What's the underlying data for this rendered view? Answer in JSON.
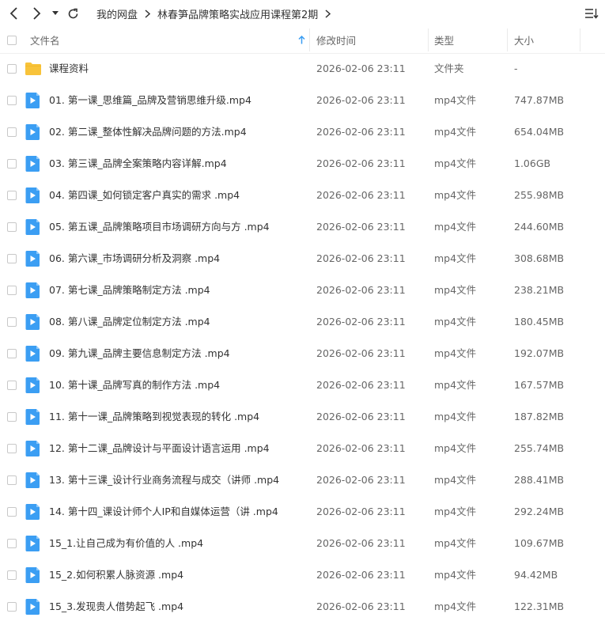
{
  "breadcrumb": [
    "我的网盘",
    "林春笋品牌策略实战应用课程第2期"
  ],
  "columns": {
    "name": "文件名",
    "modified": "修改时间",
    "type": "类型",
    "size": "大小"
  },
  "colors": {
    "folder": "#F8C33A",
    "video": "#3B9EF3"
  },
  "files": [
    {
      "icon": "folder-icon",
      "name": "课程资料",
      "modified": "2026-02-06 23:11",
      "type": "文件夹",
      "size": "-"
    },
    {
      "icon": "video-file-icon",
      "name": "01. 第一课_思维篇_品牌及营销思维升级.mp4",
      "modified": "2026-02-06 23:11",
      "type": "mp4文件",
      "size": "747.87MB"
    },
    {
      "icon": "video-file-icon",
      "name": "02. 第二课_整体性解决品牌问题的方法.mp4",
      "modified": "2026-02-06 23:11",
      "type": "mp4文件",
      "size": "654.04MB"
    },
    {
      "icon": "video-file-icon",
      "name": "03. 第三课_品牌全案策略内容详解.mp4",
      "modified": "2026-02-06 23:11",
      "type": "mp4文件",
      "size": "1.06GB"
    },
    {
      "icon": "video-file-icon",
      "name": "04. 第四课_如何锁定客户真实的需求 .mp4",
      "modified": "2026-02-06 23:11",
      "type": "mp4文件",
      "size": "255.98MB"
    },
    {
      "icon": "video-file-icon",
      "name": "05. 第五课_品牌策略项目市场调研方向与方 .mp4",
      "modified": "2026-02-06 23:11",
      "type": "mp4文件",
      "size": "244.60MB"
    },
    {
      "icon": "video-file-icon",
      "name": "06. 第六课_市场调研分析及洞察 .mp4",
      "modified": "2026-02-06 23:11",
      "type": "mp4文件",
      "size": "308.68MB"
    },
    {
      "icon": "video-file-icon",
      "name": "07. 第七课_品牌策略制定方法 .mp4",
      "modified": "2026-02-06 23:11",
      "type": "mp4文件",
      "size": "238.21MB"
    },
    {
      "icon": "video-file-icon",
      "name": "08. 第八课_品牌定位制定方法 .mp4",
      "modified": "2026-02-06 23:11",
      "type": "mp4文件",
      "size": "180.45MB"
    },
    {
      "icon": "video-file-icon",
      "name": "09. 第九课_品牌主要信息制定方法 .mp4",
      "modified": "2026-02-06 23:11",
      "type": "mp4文件",
      "size": "192.07MB"
    },
    {
      "icon": "video-file-icon",
      "name": "10. 第十课_品牌写真的制作方法 .mp4",
      "modified": "2026-02-06 23:11",
      "type": "mp4文件",
      "size": "167.57MB"
    },
    {
      "icon": "video-file-icon",
      "name": "11. 第十一课_品牌策略到视觉表现的转化 .mp4",
      "modified": "2026-02-06 23:11",
      "type": "mp4文件",
      "size": "187.82MB"
    },
    {
      "icon": "video-file-icon",
      "name": "12. 第十二课_品牌设计与平面设计语言运用 .mp4",
      "modified": "2026-02-06 23:11",
      "type": "mp4文件",
      "size": "255.74MB"
    },
    {
      "icon": "video-file-icon",
      "name": "13. 第十三课_设计行业商务流程与成交（讲师 .mp4",
      "modified": "2026-02-06 23:11",
      "type": "mp4文件",
      "size": "288.41MB"
    },
    {
      "icon": "video-file-icon",
      "name": "14. 第十四_课设计师个人IP和自媒体运营（讲 .mp4",
      "modified": "2026-02-06 23:11",
      "type": "mp4文件",
      "size": "292.24MB"
    },
    {
      "icon": "video-file-icon",
      "name": "15_1.让自己成为有价值的人 .mp4",
      "modified": "2026-02-06 23:11",
      "type": "mp4文件",
      "size": "109.67MB"
    },
    {
      "icon": "video-file-icon",
      "name": "15_2.如何积累人脉资源 .mp4",
      "modified": "2026-02-06 23:11",
      "type": "mp4文件",
      "size": "94.42MB"
    },
    {
      "icon": "video-file-icon",
      "name": "15_3.发现贵人借势起飞 .mp4",
      "modified": "2026-02-06 23:11",
      "type": "mp4文件",
      "size": "122.31MB"
    }
  ]
}
